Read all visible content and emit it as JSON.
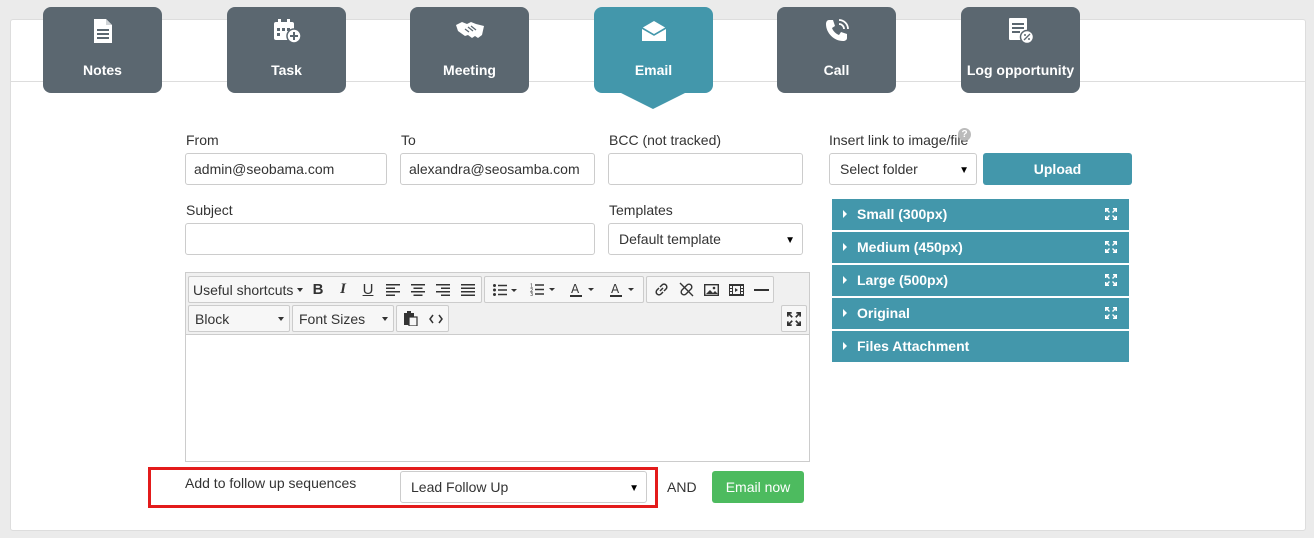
{
  "tabs": [
    {
      "label": "Notes",
      "icon": "notes-icon"
    },
    {
      "label": "Task",
      "icon": "calendar-plus-icon"
    },
    {
      "label": "Meeting",
      "icon": "handshake-icon"
    },
    {
      "label": "Email",
      "icon": "envelope-open-icon",
      "active": true
    },
    {
      "label": "Call",
      "icon": "phone-icon"
    },
    {
      "label": "Log opportunity",
      "icon": "document-percent-icon"
    }
  ],
  "form": {
    "from_label": "From",
    "from_value": "admin@seobama.com",
    "to_label": "To",
    "to_value": "alexandra@seosamba.com",
    "bcc_label": "BCC (not tracked)",
    "bcc_value": "",
    "subject_label": "Subject",
    "subject_value": "",
    "templates_label": "Templates",
    "templates_value": "Default template"
  },
  "editor": {
    "shortcuts_label": "Useful shortcuts",
    "block_label": "Block",
    "font_sizes_label": "Font Sizes"
  },
  "sidebar": {
    "insert_label": "Insert link to image/file",
    "help_icon": "?",
    "folder_value": "Select folder",
    "upload_label": "Upload",
    "accordion": [
      {
        "label": "Small (300px)",
        "expand": true
      },
      {
        "label": "Medium (450px)",
        "expand": true
      },
      {
        "label": "Large (500px)",
        "expand": true
      },
      {
        "label": "Original",
        "expand": true
      },
      {
        "label": "Files Attachment",
        "expand": false
      }
    ]
  },
  "footer": {
    "sequence_label": "Add to follow up sequences",
    "sequence_value": "Lead Follow Up",
    "and_label": "AND",
    "email_now_label": "Email now"
  },
  "colors": {
    "tab": "#5b6770",
    "tab_active": "#4397ab",
    "accent": "#4397ab",
    "green": "#4dbb5f",
    "highlight": "#e31b1b"
  }
}
